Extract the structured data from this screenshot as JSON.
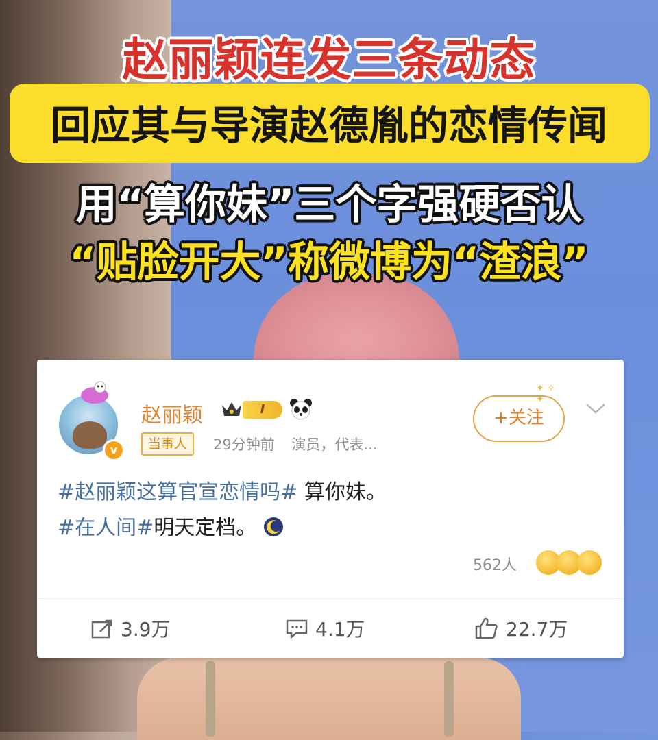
{
  "headlines": {
    "line1": "赵丽颖连发三条动态",
    "line2": "回应其与导演赵德胤的恋情传闻",
    "line3": "用“算你妹”三个字强硬否认",
    "line4": "“贴脸开大”称微博为“渣浪”"
  },
  "colors": {
    "headline_red": "#d7322b",
    "highlight_yellow": "#fbde2b",
    "username_orange": "#e3832d",
    "hashtag_blue": "#466f9e"
  },
  "post": {
    "username": "赵丽颖",
    "level": "I",
    "tag": "当事人",
    "time": "29分钟前",
    "description": "演员，代表...",
    "follow_label": "+关注",
    "verified_mark": "v",
    "line1_hashtag": "#赵丽颖这算官宣恋情吗#",
    "line1_text": " 算你妹。",
    "line2_hashtag": "#在人间#",
    "line2_text": "明天定档。",
    "reaction_count": "562人",
    "actions": {
      "repost": "3.9万",
      "comment": "4.1万",
      "like": "22.7万"
    },
    "icons": [
      "crown-icon",
      "panda-icon",
      "moon-emoji-icon",
      "chevron-down-icon",
      "repost-icon",
      "comment-icon",
      "like-icon"
    ]
  }
}
